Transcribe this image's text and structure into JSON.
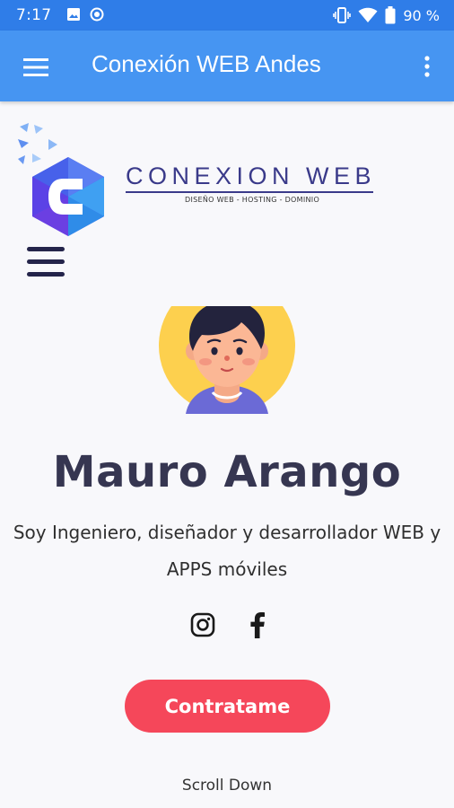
{
  "status_bar": {
    "time": "7:17",
    "battery": "90 %",
    "icons": [
      "image-icon",
      "record-icon",
      "vibrate-icon",
      "wifi-icon",
      "battery-icon"
    ]
  },
  "app_bar": {
    "title": "Conexión WEB Andes",
    "menu_icon": "hamburger-menu-icon",
    "more_icon": "more-vert-icon",
    "background": "#4695f2"
  },
  "site": {
    "logo": {
      "name": "CONEXION WEB",
      "tagline": "DISEÑO WEB - HOSTING - DOMINIO"
    },
    "menu_icon": "hamburger-menu-icon"
  },
  "profile": {
    "name": "Mauro Arango",
    "bio": "Soy Ingeniero, diseñador y desarrollador WEB y APPS móviles",
    "social": [
      "instagram-icon",
      "facebook-icon"
    ]
  },
  "cta": {
    "label": "Contratame",
    "color": "#f5475a"
  },
  "scroll_hint": "Scroll Down"
}
